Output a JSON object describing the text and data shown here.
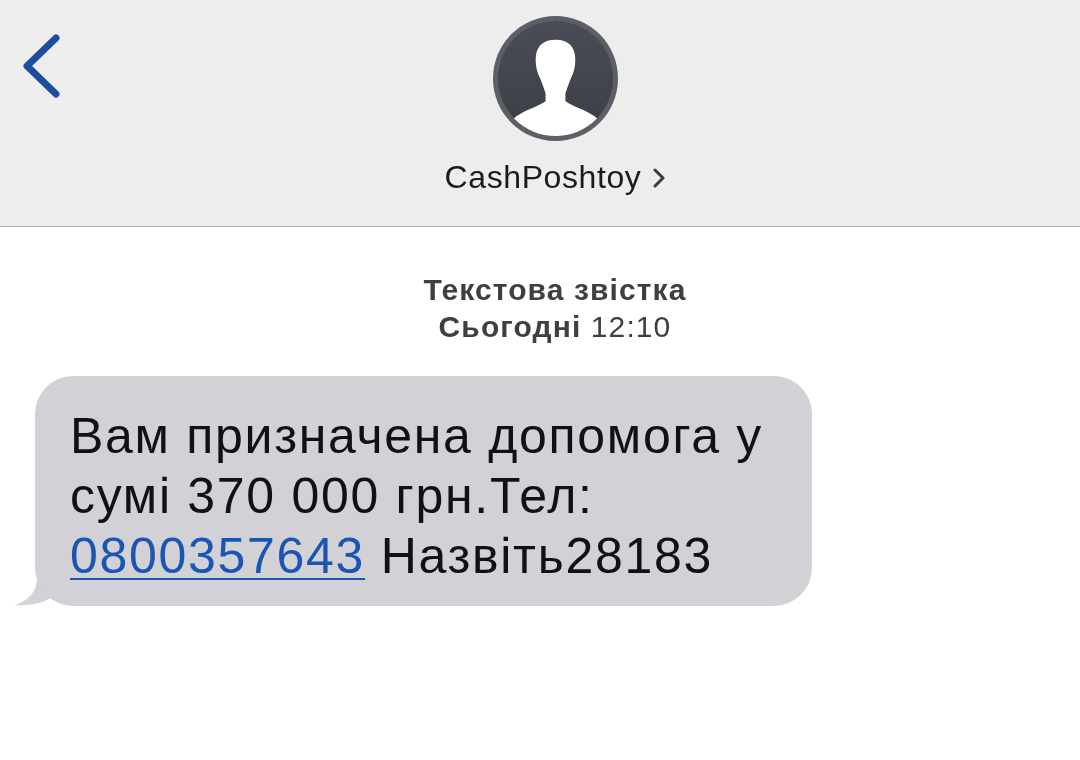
{
  "navigation_bar": {
    "contact": {
      "name": "CashPoshtoy"
    }
  },
  "conversation": {
    "header": {
      "label": "Текстова звістка",
      "timestamp": "**Сьогодні** 12:10"
    },
    "messages": [
      {
        "incoming": true,
        "parts": [
          {
            "kind": "text",
            "text": "Вам призначена допомога у сумі 370 000 грн.Тел:"
          },
          {
            "kind": "link",
            "text": "0800357643"
          },
          {
            "kind": "text",
            "text": "Назвіть28183"
          }
        ]
      }
    ]
  }
}
